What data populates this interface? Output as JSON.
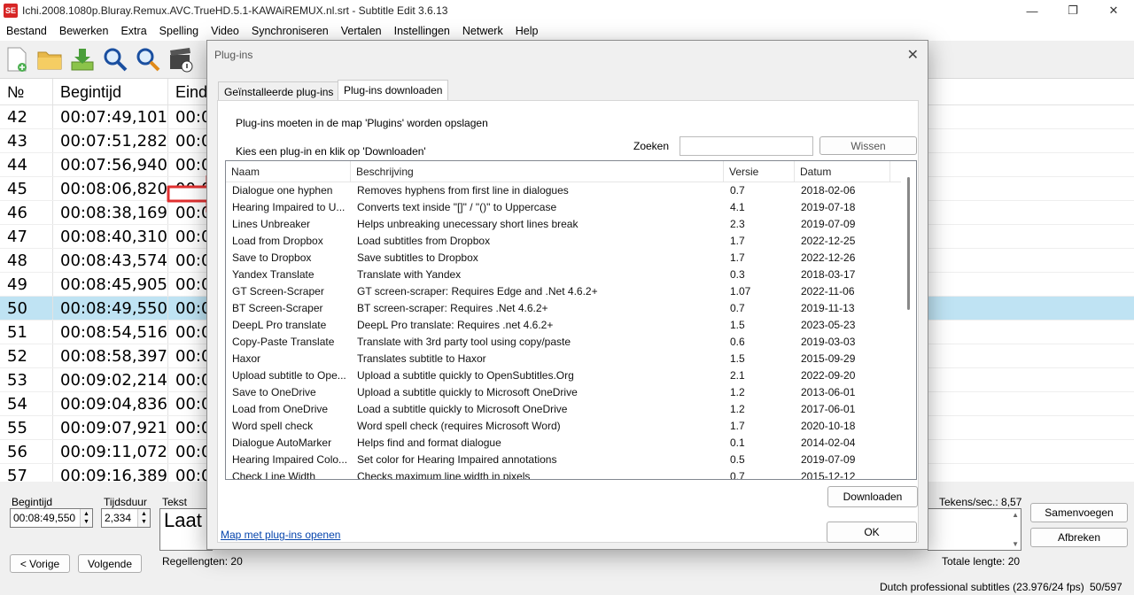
{
  "window": {
    "logo": "SE",
    "title": "Ichi.2008.1080p.Bluray.Remux.AVC.TrueHD.5.1-KAWAiREMUX.nl.srt - Subtitle Edit 3.6.13",
    "min": "—",
    "max": "❐",
    "close": "✕"
  },
  "menu": [
    "Bestand",
    "Bewerken",
    "Extra",
    "Spelling",
    "Video",
    "Synchroniseren",
    "Vertalen",
    "Instellingen",
    "Netwerk",
    "Help"
  ],
  "grid": {
    "headers": [
      "№",
      "Begintijd",
      "Eind"
    ],
    "rows": [
      {
        "n": "42",
        "t": "00:07:49,101",
        "e": "00:0"
      },
      {
        "n": "43",
        "t": "00:07:51,282",
        "e": "00:0"
      },
      {
        "n": "44",
        "t": "00:07:56,940",
        "e": "00:0"
      },
      {
        "n": "45",
        "t": "00:08:06,820",
        "e": "00:0"
      },
      {
        "n": "46",
        "t": "00:08:38,169",
        "e": "00:0"
      },
      {
        "n": "47",
        "t": "00:08:40,310",
        "e": "00:0"
      },
      {
        "n": "48",
        "t": "00:08:43,574",
        "e": "00:0"
      },
      {
        "n": "49",
        "t": "00:08:45,905",
        "e": "00:0"
      },
      {
        "n": "50",
        "t": "00:08:49,550",
        "e": "00:0"
      },
      {
        "n": "51",
        "t": "00:08:54,516",
        "e": "00:0"
      },
      {
        "n": "52",
        "t": "00:08:58,397",
        "e": "00:0"
      },
      {
        "n": "53",
        "t": "00:09:02,214",
        "e": "00:0"
      },
      {
        "n": "54",
        "t": "00:09:04,836",
        "e": "00:0"
      },
      {
        "n": "55",
        "t": "00:09:07,921",
        "e": "00:0"
      },
      {
        "n": "56",
        "t": "00:09:11,072",
        "e": "00:0"
      },
      {
        "n": "57",
        "t": "00:09:16,389",
        "e": "00:0"
      }
    ]
  },
  "edit": {
    "begin_label": "Begintijd",
    "begin_value": "00:08:49,550",
    "dur_label": "Tijdsduur",
    "dur_value": "2,334",
    "text_label": "Tekst",
    "text_value": "Laat",
    "prev": "< Vorige",
    "next": "Volgende",
    "line_lengths": "Regellengten: 20",
    "chars_sec": "Tekens/sec.: 8,57",
    "total_length": "Totale lengte: 20",
    "merge": "Samenvoegen",
    "split": "Afbreken"
  },
  "status": {
    "format": "Dutch professional subtitles (23.976/24 fps)",
    "position": "50/597"
  },
  "dialog": {
    "title": "Plug-ins",
    "close": "✕",
    "tab_installed": "Geïnstalleerde plug-ins",
    "tab_download": "Plug-ins downloaden",
    "info": "Plug-ins moeten in de map 'Plugins' worden opslagen",
    "choose": "Kies een plug-in en klik op 'Downloaden'",
    "search_label": "Zoeken",
    "search_value": "",
    "clear": "Wissen",
    "columns": [
      "Naam",
      "Beschrijving",
      "Versie",
      "Datum"
    ],
    "plugins": [
      {
        "name": "Dialogue one hyphen",
        "desc": "Removes hyphens from first line in dialogues",
        "ver": "0.7",
        "date": "2018-02-06"
      },
      {
        "name": "Hearing Impaired to U...",
        "desc": "Converts text inside \"[]\" / \"()\" to Uppercase",
        "ver": "4.1",
        "date": "2019-07-18"
      },
      {
        "name": "Lines Unbreaker",
        "desc": "Helps unbreaking unecessary short lines break",
        "ver": "2.3",
        "date": "2019-07-09"
      },
      {
        "name": "Load from Dropbox",
        "desc": "Load subtitles from Dropbox",
        "ver": "1.7",
        "date": "2022-12-25"
      },
      {
        "name": "Save to Dropbox",
        "desc": "Save subtitles to Dropbox",
        "ver": "1.7",
        "date": "2022-12-26"
      },
      {
        "name": "Yandex Translate",
        "desc": "Translate with Yandex",
        "ver": "0.3",
        "date": "2018-03-17"
      },
      {
        "name": "GT Screen-Scraper",
        "desc": "GT screen-scraper: Requires Edge and .Net 4.6.2+",
        "ver": "1.07",
        "date": "2022-11-06"
      },
      {
        "name": "BT Screen-Scraper",
        "desc": "BT screen-scraper: Requires .Net 4.6.2+",
        "ver": "0.7",
        "date": "2019-11-13"
      },
      {
        "name": "DeepL Pro translate",
        "desc": "DeepL Pro translate: Requires .net 4.6.2+",
        "ver": "1.5",
        "date": "2023-05-23"
      },
      {
        "name": "Copy-Paste Translate",
        "desc": "Translate with 3rd party tool using copy/paste",
        "ver": "0.6",
        "date": "2019-03-03"
      },
      {
        "name": "Haxor",
        "desc": "Translates subtitle to Haxor",
        "ver": "1.5",
        "date": "2015-09-29"
      },
      {
        "name": "Upload subtitle to Ope...",
        "desc": "Upload a subtitle quickly to OpenSubtitles.Org",
        "ver": "2.1",
        "date": "2022-09-20"
      },
      {
        "name": "Save to OneDrive",
        "desc": "Upload a subtitle quickly to Microsoft OneDrive",
        "ver": "1.2",
        "date": "2013-06-01"
      },
      {
        "name": "Load from OneDrive",
        "desc": "Load a subtitle quickly to Microsoft OneDrive",
        "ver": "1.2",
        "date": "2017-06-01"
      },
      {
        "name": "Word spell check",
        "desc": "Word spell check (requires Microsoft Word)",
        "ver": "1.7",
        "date": "2020-10-18"
      },
      {
        "name": "Dialogue AutoMarker",
        "desc": "Helps find and format dialogue",
        "ver": "0.1",
        "date": "2014-02-04"
      },
      {
        "name": "Hearing Impaired Colo...",
        "desc": "Set color for Hearing Impaired annotations",
        "ver": "0.5",
        "date": "2019-07-09"
      },
      {
        "name": "Check Line Width",
        "desc": "Checks maximum line width in pixels",
        "ver": "0.7",
        "date": "2015-12-12"
      }
    ],
    "download": "Downloaden",
    "open_folder": "Map met plug-ins openen",
    "ok": "OK"
  },
  "annotation_color": "#e03030",
  "selection_color": "#bfe3f3"
}
